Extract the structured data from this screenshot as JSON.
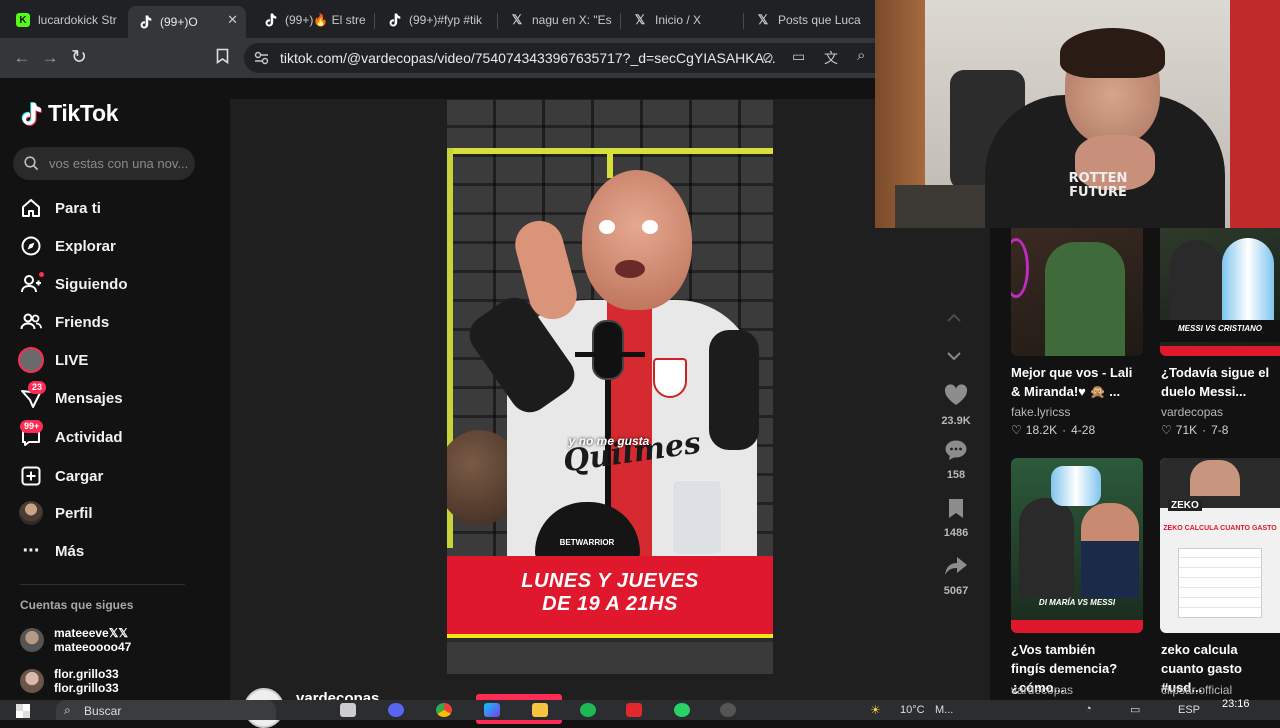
{
  "browser": {
    "tabs": [
      {
        "title": "lucardokick Str",
        "favicon": "kick-icon",
        "color": "#53fc18"
      },
      {
        "title": "(99+)O",
        "favicon": "tiktok-icon",
        "color": "#ffffff",
        "active": true
      },
      {
        "title": "(99+)🔥 El stre",
        "favicon": "tiktok-icon",
        "color": "#ffffff"
      },
      {
        "title": "(99+)#fyp #tik",
        "favicon": "tiktok-icon",
        "color": "#ffffff"
      },
      {
        "title": "nagu en X: \"Es",
        "favicon": "x-icon",
        "color": "#ffffff"
      },
      {
        "title": "Inicio / X",
        "favicon": "x-icon",
        "color": "#ffffff"
      },
      {
        "title": "Posts que Luca",
        "favicon": "x-icon",
        "color": "#ffffff"
      }
    ],
    "url": "tiktok.com/@vardecopas/video/7540743433967635717?_d=secCgYIASAHKA..."
  },
  "tiktok": {
    "logo": "TikTok",
    "search_placeholder": "vos estas con una nov...",
    "nav": [
      {
        "label": "Para ti",
        "icon": "home-icon"
      },
      {
        "label": "Explorar",
        "icon": "compass-icon"
      },
      {
        "label": "Siguiendo",
        "icon": "following-icon"
      },
      {
        "label": "Friends",
        "icon": "friends-icon"
      },
      {
        "label": "LIVE",
        "icon": "live-icon"
      },
      {
        "label": "Mensajes",
        "icon": "messages-icon",
        "badge": "23"
      },
      {
        "label": "Actividad",
        "icon": "activity-icon",
        "badge": "99+"
      },
      {
        "label": "Cargar",
        "icon": "upload-icon"
      },
      {
        "label": "Perfil",
        "icon": "profile-avatar"
      },
      {
        "label": "Más",
        "icon": "more-icon"
      }
    ],
    "following_title": "Cuentas que sigues",
    "following": [
      {
        "name": "mateeeve𝕏𝕏",
        "handle": "mateeoooo47"
      },
      {
        "name": "flor.grillo33",
        "handle": "flor.grillo33"
      }
    ],
    "video": {
      "caption": "y no me gusta",
      "banner_line1": "LUNES Y JUEVES",
      "banner_line2": "DE 19 A 21HS",
      "shirt_text": "Quilmes",
      "cap_text": "BETWARRIOR"
    },
    "actions": {
      "likes": "23.9K",
      "comments": "158",
      "saves": "1486",
      "shares": "5067"
    },
    "author": "vardecopas",
    "colors": {
      "accent": "#fe2c55",
      "banner": "#e0182d",
      "banner_border": "#f5e51b"
    }
  },
  "recommended": [
    {
      "title": "Mejor que vos - Lali & Miranda!♥ 🙊 ...",
      "author": "fake.lyricss",
      "likes": "18.2K",
      "date": "4-28",
      "thumb_label": ""
    },
    {
      "title": "¿Todavía sigue el duelo Messi...",
      "author": "vardecopas",
      "likes": "71K",
      "date": "7-8",
      "thumb_label": "MESSI VS CRISTIANO"
    },
    {
      "title": "¿Vos también fingís demencia? ¿cómo...",
      "author": "vardecopas",
      "likes": "",
      "date": "",
      "thumb_label": "DI MARÍA VS MESSI"
    },
    {
      "title": "zeko calcula cuanto gasto #usd...",
      "author": "clipsar.official",
      "likes": "",
      "date": "",
      "thumb_label": "ZEKO CALCULA CUANTO GASTO",
      "thumb_brand": "ZEKO"
    }
  ],
  "webcam": {
    "shirt_text": "ROTTEN FUTURE"
  },
  "taskbar": {
    "search_label": "Buscar",
    "weather": "10°C",
    "weather_text": "M...",
    "lang": "ESP",
    "time": "23:16"
  }
}
